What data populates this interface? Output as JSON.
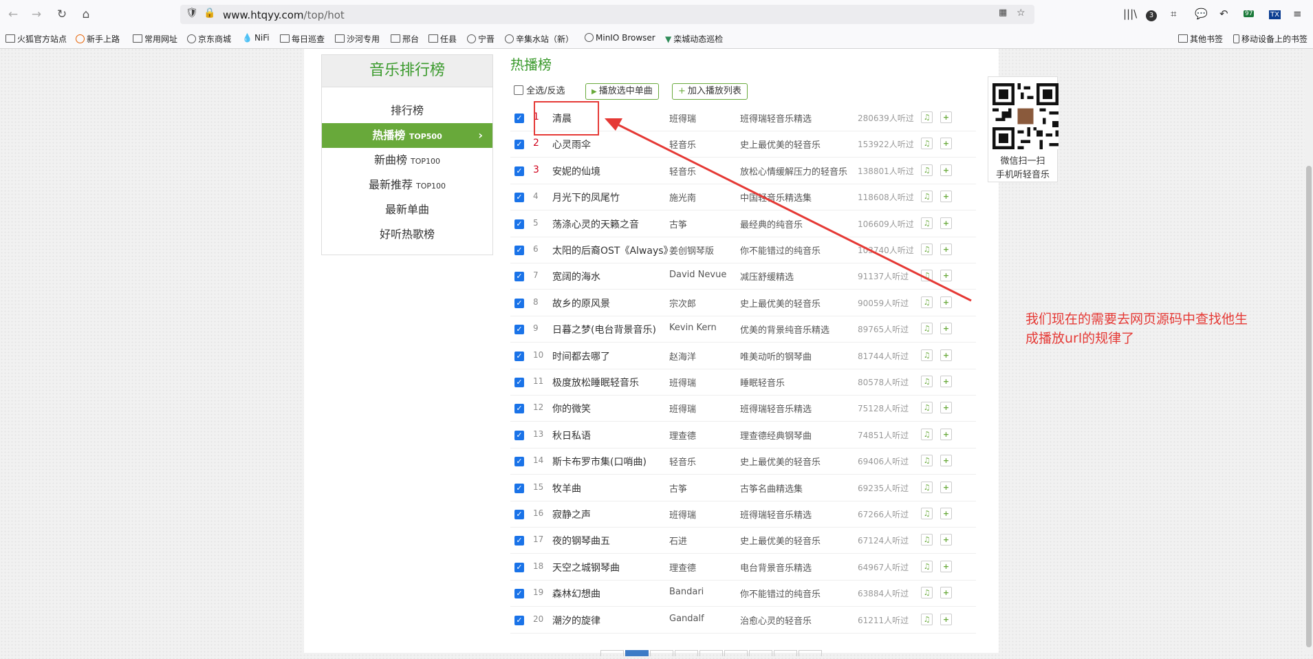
{
  "browser": {
    "url_domain": "www.htqyy.com",
    "url_path": "/top/hot",
    "update_badge": "97",
    "account_badge": "3",
    "ext_label": "TX"
  },
  "bookmarks": [
    {
      "label": "火狐官方站点",
      "icon": "folder"
    },
    {
      "label": "新手上路",
      "icon": "firefox"
    },
    {
      "label": "常用网址",
      "icon": "folder"
    },
    {
      "label": "京东商城",
      "icon": "globe"
    },
    {
      "label": "NiFi",
      "icon": "nifi"
    },
    {
      "label": "每日巡查",
      "icon": "folder"
    },
    {
      "label": "沙河专用",
      "icon": "folder"
    },
    {
      "label": "邢台",
      "icon": "folder"
    },
    {
      "label": "任县",
      "icon": "folder"
    },
    {
      "label": "宁晋",
      "icon": "globe"
    },
    {
      "label": "辛集水站（新）",
      "icon": "globe"
    },
    {
      "label": "MinIO Browser",
      "icon": "globe"
    },
    {
      "label": "栾城动态巡检",
      "icon": "leaf"
    },
    {
      "label": "其他书签",
      "icon": "folder"
    },
    {
      "label": "移动设备上的书签",
      "icon": "mobile"
    }
  ],
  "sidebar": {
    "title": "音乐排行榜",
    "items": [
      {
        "label": "排行榜",
        "suffix": ""
      },
      {
        "label": "热播榜",
        "suffix": "TOP500"
      },
      {
        "label": "新曲榜",
        "suffix": "TOP100"
      },
      {
        "label": "最新推荐",
        "suffix": "TOP100"
      },
      {
        "label": "最新单曲",
        "suffix": ""
      },
      {
        "label": "好听热歌榜",
        "suffix": ""
      }
    ]
  },
  "main": {
    "title": "热播榜",
    "select_all": "全选/反选",
    "play_selected": "播放选中单曲",
    "add_playlist": "加入播放列表"
  },
  "songs": [
    {
      "rank": "1",
      "title": "清晨",
      "artist": "班得瑞",
      "album": "班得瑞轻音乐精选",
      "plays": "280639人听过"
    },
    {
      "rank": "2",
      "title": "心灵雨伞",
      "artist": "轻音乐",
      "album": "史上最优美的轻音乐",
      "plays": "153922人听过"
    },
    {
      "rank": "3",
      "title": "安妮的仙境",
      "artist": "轻音乐",
      "album": "放松心情缓解压力的轻音乐",
      "plays": "138801人听过"
    },
    {
      "rank": "4",
      "title": "月光下的凤尾竹",
      "artist": "施光南",
      "album": "中国轻音乐精选集",
      "plays": "118608人听过"
    },
    {
      "rank": "5",
      "title": "荡涤心灵的天籁之音",
      "artist": "古筝",
      "album": "最经典的纯音乐",
      "plays": "106609人听过"
    },
    {
      "rank": "6",
      "title": "太阳的后裔OST《Always》",
      "artist": "姜创钢琴版",
      "album": "你不能错过的纯音乐",
      "plays": "103740人听过"
    },
    {
      "rank": "7",
      "title": "宽阔的海水",
      "artist": "David Nevue",
      "album": "减压舒缓精选",
      "plays": "91137人听过"
    },
    {
      "rank": "8",
      "title": "故乡的原风景",
      "artist": "宗次郎",
      "album": "史上最优美的轻音乐",
      "plays": "90059人听过"
    },
    {
      "rank": "9",
      "title": "日暮之梦(电台背景音乐)",
      "artist": "Kevin Kern",
      "album": "优美的背景纯音乐精选",
      "plays": "89765人听过"
    },
    {
      "rank": "10",
      "title": "时间都去哪了",
      "artist": "赵海洋",
      "album": "唯美动听的钢琴曲",
      "plays": "81744人听过"
    },
    {
      "rank": "11",
      "title": "极度放松睡眠轻音乐",
      "artist": "班得瑞",
      "album": "睡眠轻音乐",
      "plays": "80578人听过"
    },
    {
      "rank": "12",
      "title": "你的微笑",
      "artist": "班得瑞",
      "album": "班得瑞轻音乐精选",
      "plays": "75128人听过"
    },
    {
      "rank": "13",
      "title": "秋日私语",
      "artist": "理查德",
      "album": "理查德经典钢琴曲",
      "plays": "74851人听过"
    },
    {
      "rank": "14",
      "title": "斯卡布罗市集(口哨曲)",
      "artist": "轻音乐",
      "album": "史上最优美的轻音乐",
      "plays": "69406人听过"
    },
    {
      "rank": "15",
      "title": "牧羊曲",
      "artist": "古筝",
      "album": "古筝名曲精选集",
      "plays": "69235人听过"
    },
    {
      "rank": "16",
      "title": "寂静之声",
      "artist": "班得瑞",
      "album": "班得瑞轻音乐精选",
      "plays": "67266人听过"
    },
    {
      "rank": "17",
      "title": "夜的钢琴曲五",
      "artist": "石进",
      "album": "史上最优美的轻音乐",
      "plays": "67124人听过"
    },
    {
      "rank": "18",
      "title": "天空之城钢琴曲",
      "artist": "理查德",
      "album": "电台背景音乐精选",
      "plays": "64967人听过"
    },
    {
      "rank": "19",
      "title": "森林幻想曲",
      "artist": "Bandari",
      "album": "你不能错过的纯音乐",
      "plays": "63884人听过"
    },
    {
      "rank": "20",
      "title": "潮汐的旋律",
      "artist": "Gandalf",
      "album": "治愈心灵的轻音乐",
      "plays": "61211人听过"
    }
  ],
  "qr": {
    "line1": "微信扫一扫",
    "line2": "手机听轻音乐"
  },
  "annotation": "我们现在的需要去网页源码中查找他生成播放url的规律了",
  "colors": {
    "accent_green": "#68a93a",
    "title_green": "#3a9a2c",
    "annotation_red": "#e53935",
    "checkbox_blue": "#1a73e8"
  }
}
